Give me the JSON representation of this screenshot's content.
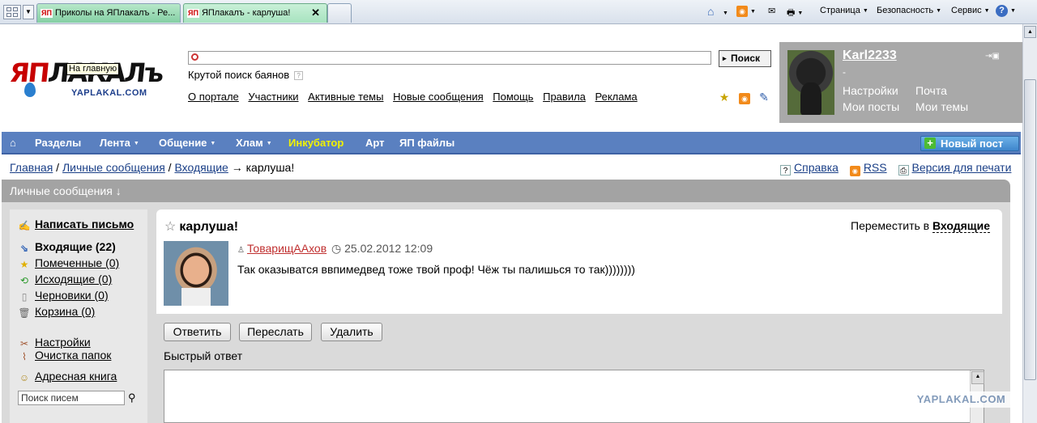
{
  "browser": {
    "tabs": [
      {
        "label": "Приколы на ЯПлакалъ - Ре...",
        "icon": "ЯП"
      },
      {
        "label": "ЯПлакалъ - карлуша!",
        "icon": "ЯП"
      }
    ],
    "commands": {
      "page": "Страница",
      "security": "Безопасность",
      "service": "Сервис"
    }
  },
  "header": {
    "logo_main_red": "ЯП",
    "logo_main_rest": "ЛАКАЛъ",
    "logo_sub": "YAPLAKAL.COM",
    "tooltip": "На главную",
    "search_placeholder": "",
    "search_button": "Поиск",
    "slogan": "Крутой поиск баянов",
    "slogan_help": "?",
    "links": [
      "О портале",
      "Участники",
      "Активные темы",
      "Новые сообщения",
      "Помощь",
      "Правила",
      "Реклама"
    ]
  },
  "user": {
    "name": "Karl2233",
    "status": "-",
    "links": [
      "Настройки",
      "Почта",
      "Мои посты",
      "Мои темы"
    ]
  },
  "nav": {
    "items": [
      "Разделы",
      "Лента",
      "Общение",
      "Хлам",
      "Инкубатор",
      "Арт",
      "ЯП файлы"
    ],
    "new_post": "Новый пост"
  },
  "breadcrumbs": {
    "home": "Главная",
    "sep1": " / ",
    "pm": "Личные сообщения",
    "sep2": " / ",
    "inbox": "Входящие",
    "arrow": " → карлуша!"
  },
  "toplinks_right": [
    "Справка",
    "RSS",
    "Версия для печати"
  ],
  "panel_title": "Личные сообщения ↓",
  "sidebar": {
    "compose": "Написать письмо",
    "inbox": "Входящие (22)",
    "starred": "Помеченные (0)",
    "sent": "Исходящие (0)",
    "drafts": "Черновики (0)",
    "trash": "Корзина (0)",
    "settings": "Настройки",
    "clean": "Очистка папок",
    "addressbook": "Адресная книга",
    "search_placeholder": "Поиск писем"
  },
  "message": {
    "title": "карлуша!",
    "move_label": "Переместить в ",
    "move_target": "Входящие",
    "author": "ТоварищААхов",
    "date": "25.02.2012 12:09",
    "body": "Так оказыватся ввпимедвед тоже твой проф! Чёж ты палишься то так))))))))"
  },
  "actions": {
    "reply": "Ответить",
    "forward": "Переслать",
    "delete": "Удалить"
  },
  "quick_reply_label": "Быстрый ответ",
  "watermark": "YAPLAKAL.COM"
}
